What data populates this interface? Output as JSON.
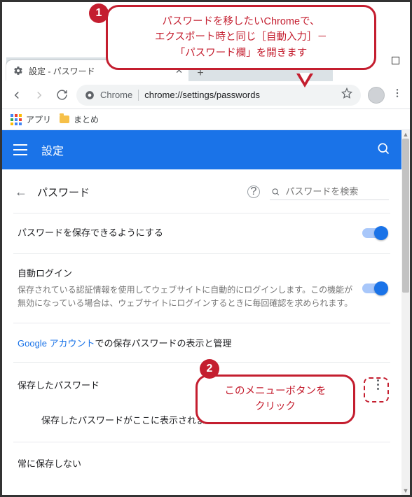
{
  "window": {
    "tab_title": "設定 - パスワード",
    "minimize": "–",
    "new_tab": "+"
  },
  "address_bar": {
    "chrome_label": "Chrome",
    "url": "chrome://settings/passwords"
  },
  "bookmarks": {
    "apps_label": "アプリ",
    "folder1": "まとめ"
  },
  "appbar": {
    "title": "設定"
  },
  "page": {
    "back": "←",
    "title": "パスワード",
    "help_glyph": "?",
    "search_placeholder": "パスワードを検索"
  },
  "rows": {
    "save_passwords_label": "パスワードを保存できるようにする",
    "auto_signin_label": "自動ログイン",
    "auto_signin_desc": "保存されている認証情報を使用してウェブサイトに自動的にログインします。この機能が無効になっている場合は、ウェブサイトにログインするときに毎回確認を求められます。",
    "google_link_text": "Google アカウント",
    "google_link_suffix": "での保存パスワードの表示と管理",
    "saved_section_label": "保存したパスワード",
    "saved_empty_text": "保存したパスワードがここに表示されます",
    "never_section_label": "常に保存しない"
  },
  "annotations": {
    "callout1_line1": "パスワードを移したいChromeで、",
    "callout1_line2": "エクスポート時と同じ［自動入力］－",
    "callout1_line3": "「パスワード欄」を開きます",
    "callout2_line1": "このメニューボタンを",
    "callout2_line2": "クリック",
    "bubble1": "1",
    "bubble2": "2"
  }
}
